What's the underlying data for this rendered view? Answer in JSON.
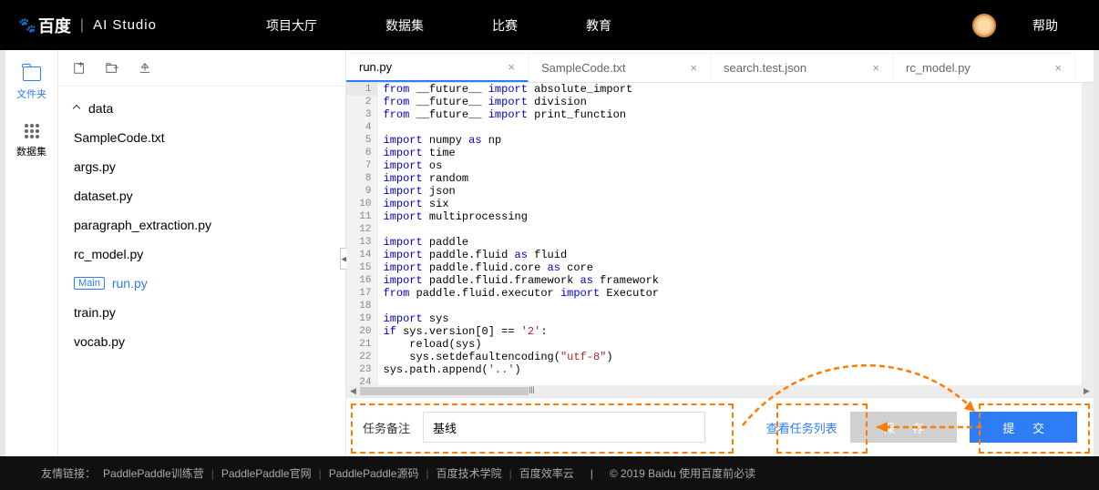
{
  "nav": {
    "logo_cn": "百度",
    "logo_ai": "AI Studio",
    "items": [
      "项目大厅",
      "数据集",
      "比赛",
      "教育"
    ],
    "help": "帮助"
  },
  "rail": {
    "folder_label": "文件夹",
    "dataset_label": "数据集"
  },
  "tree": {
    "folder": "data",
    "files": [
      "SampleCode.txt",
      "args.py",
      "dataset.py",
      "paragraph_extraction.py",
      "rc_model.py"
    ],
    "main_badge": "Main",
    "main_file": "run.py",
    "files2": [
      "train.py",
      "vocab.py"
    ]
  },
  "tabs": [
    {
      "label": "run.py"
    },
    {
      "label": "SampleCode.txt"
    },
    {
      "label": "search.test.json"
    },
    {
      "label": "rc_model.py"
    }
  ],
  "code_lines": [
    [
      [
        "kw-blue",
        "from"
      ],
      [
        "",
        " __future__ "
      ],
      [
        "kw-blue",
        "import"
      ],
      [
        "",
        " absolute_import"
      ]
    ],
    [
      [
        "kw-blue",
        "from"
      ],
      [
        "",
        " __future__ "
      ],
      [
        "kw-blue",
        "import"
      ],
      [
        "",
        " division"
      ]
    ],
    [
      [
        "kw-blue",
        "from"
      ],
      [
        "",
        " __future__ "
      ],
      [
        "kw-blue",
        "import"
      ],
      [
        "",
        " print_function"
      ]
    ],
    [],
    [
      [
        "kw-blue",
        "import"
      ],
      [
        "",
        " numpy "
      ],
      [
        "kw-blue",
        "as"
      ],
      [
        "",
        " np"
      ]
    ],
    [
      [
        "kw-blue",
        "import"
      ],
      [
        "",
        " time"
      ]
    ],
    [
      [
        "kw-blue",
        "import"
      ],
      [
        "",
        " os"
      ]
    ],
    [
      [
        "kw-blue",
        "import"
      ],
      [
        "",
        " random"
      ]
    ],
    [
      [
        "kw-blue",
        "import"
      ],
      [
        "",
        " json"
      ]
    ],
    [
      [
        "kw-blue",
        "import"
      ],
      [
        "",
        " six"
      ]
    ],
    [
      [
        "kw-blue",
        "import"
      ],
      [
        "",
        " multiprocessing"
      ]
    ],
    [],
    [
      [
        "kw-blue",
        "import"
      ],
      [
        "",
        " paddle"
      ]
    ],
    [
      [
        "kw-blue",
        "import"
      ],
      [
        "",
        " paddle.fluid "
      ],
      [
        "kw-blue",
        "as"
      ],
      [
        "",
        " fluid"
      ]
    ],
    [
      [
        "kw-blue",
        "import"
      ],
      [
        "",
        " paddle.fluid.core "
      ],
      [
        "kw-blue",
        "as"
      ],
      [
        "",
        " core"
      ]
    ],
    [
      [
        "kw-blue",
        "import"
      ],
      [
        "",
        " paddle.fluid.framework "
      ],
      [
        "kw-blue",
        "as"
      ],
      [
        "",
        " framework"
      ]
    ],
    [
      [
        "kw-blue",
        "from"
      ],
      [
        "",
        " paddle.fluid.executor "
      ],
      [
        "kw-blue",
        "import"
      ],
      [
        "",
        " Executor"
      ]
    ],
    [],
    [
      [
        "kw-blue",
        "import"
      ],
      [
        "",
        " sys"
      ]
    ],
    [
      [
        "kw-blue",
        "if"
      ],
      [
        "",
        " sys.version[0] == "
      ],
      [
        "kw-str",
        "'2'"
      ],
      [
        "",
        ":"
      ]
    ],
    [
      [
        "",
        "    reload(sys)"
      ]
    ],
    [
      [
        "",
        "    sys.setdefaultencoding("
      ],
      [
        "kw-str",
        "\"utf-8\""
      ],
      [
        "",
        ")"
      ]
    ],
    [
      [
        "",
        "sys.path.append("
      ],
      [
        "kw-str",
        "'..'"
      ],
      [
        "",
        ")"
      ]
    ],
    []
  ],
  "actions": {
    "task_label": "任务备注",
    "task_value": "基线",
    "view_tasks": "查看任务列表",
    "save": "保 存",
    "submit": "提 交"
  },
  "footer": {
    "label": "友情链接：",
    "links": [
      "PaddlePaddle训练营",
      "PaddlePaddle官网",
      "PaddlePaddle源码",
      "百度技术学院",
      "百度效率云"
    ],
    "copyright": "© 2019 Baidu 使用百度前必读"
  }
}
